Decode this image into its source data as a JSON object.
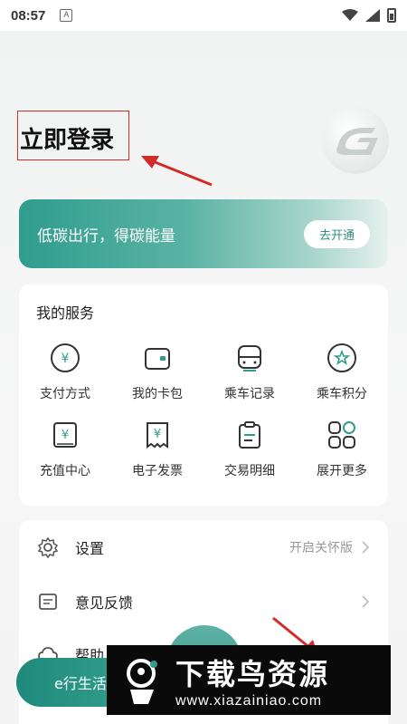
{
  "status_bar": {
    "time": "08:57",
    "notification_glyph": "A"
  },
  "header": {
    "login_label": "立即登录"
  },
  "banner": {
    "text": "低碳出行，得碳能量",
    "button": "去开通"
  },
  "services": {
    "title": "我的服务",
    "items": [
      {
        "label": "支付方式",
        "icon": "yuan-circle-icon"
      },
      {
        "label": "我的卡包",
        "icon": "wallet-icon"
      },
      {
        "label": "乘车记录",
        "icon": "bus-icon"
      },
      {
        "label": "乘车积分",
        "icon": "star-badge-icon"
      },
      {
        "label": "充值中心",
        "icon": "book-yuan-icon"
      },
      {
        "label": "电子发票",
        "icon": "receipt-icon"
      },
      {
        "label": "交易明细",
        "icon": "clipboard-icon"
      },
      {
        "label": "展开更多",
        "icon": "grid-more-icon"
      }
    ]
  },
  "settings": {
    "items": [
      {
        "label": "设置",
        "right_text": "开启关怀版",
        "icon": "gear-icon"
      },
      {
        "label": "意见反馈",
        "right_text": "",
        "icon": "feedback-icon"
      },
      {
        "label": "帮助",
        "right_text": "",
        "icon": "cloud-icon"
      }
    ]
  },
  "bottom_nav": {
    "left_label": "e行生活"
  },
  "watermark": {
    "title": "下载鸟资源",
    "url": "www.xiazainiao.com"
  },
  "colors": {
    "accent": "#2f9d8d",
    "annotation": "#d32a2a"
  }
}
